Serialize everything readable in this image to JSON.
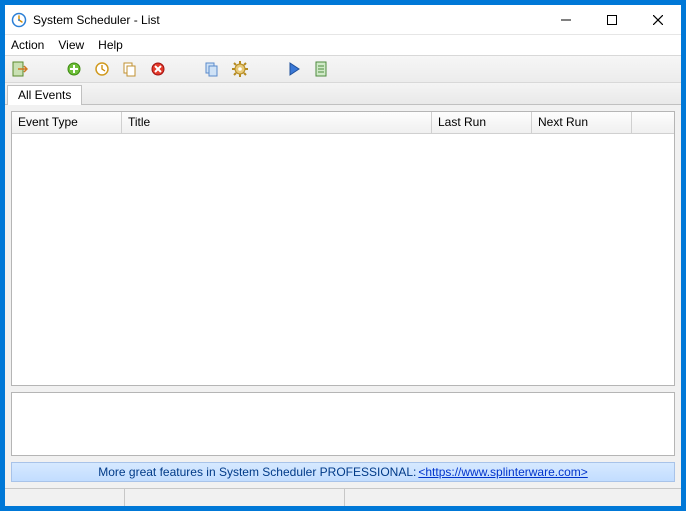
{
  "window": {
    "title": "System Scheduler - List"
  },
  "menubar": {
    "action": "Action",
    "view": "View",
    "help": "Help"
  },
  "tabs": {
    "all_events": "All Events"
  },
  "columns": {
    "event_type": "Event Type",
    "title": "Title",
    "last_run": "Last Run",
    "next_run": "Next Run"
  },
  "promo": {
    "text": "More great features in System Scheduler PROFESSIONAL: ",
    "link": "<https://www.splinterware.com>"
  },
  "rows": []
}
